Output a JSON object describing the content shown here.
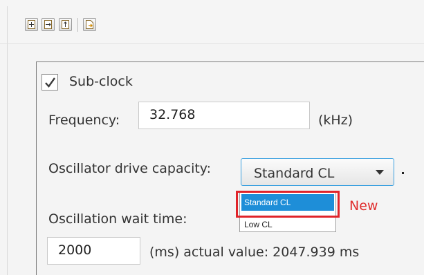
{
  "toolbar": {
    "buttons": [
      {
        "icon": "split-horizontal-icon"
      },
      {
        "icon": "split-vertical-icon"
      },
      {
        "icon": "split-column-icon"
      },
      {
        "icon": "document-export-icon"
      }
    ]
  },
  "subclock": {
    "checkbox_label": "Sub-clock",
    "checked": true,
    "frequency_label": "Frequency:",
    "frequency_value": "32.768",
    "frequency_unit": "(kHz)",
    "drive_label": "Oscillator drive capacity:",
    "drive_selected": "Standard CL",
    "drive_options": [
      "Standard CL",
      "Low CL"
    ],
    "wait_label": "Oscillation wait time:",
    "wait_value": "2000",
    "wait_unit_actual": "(ms) actual value: 2047.939 ms"
  },
  "annotation": {
    "new_label": "New",
    "highlight_color": "#e0242a"
  }
}
